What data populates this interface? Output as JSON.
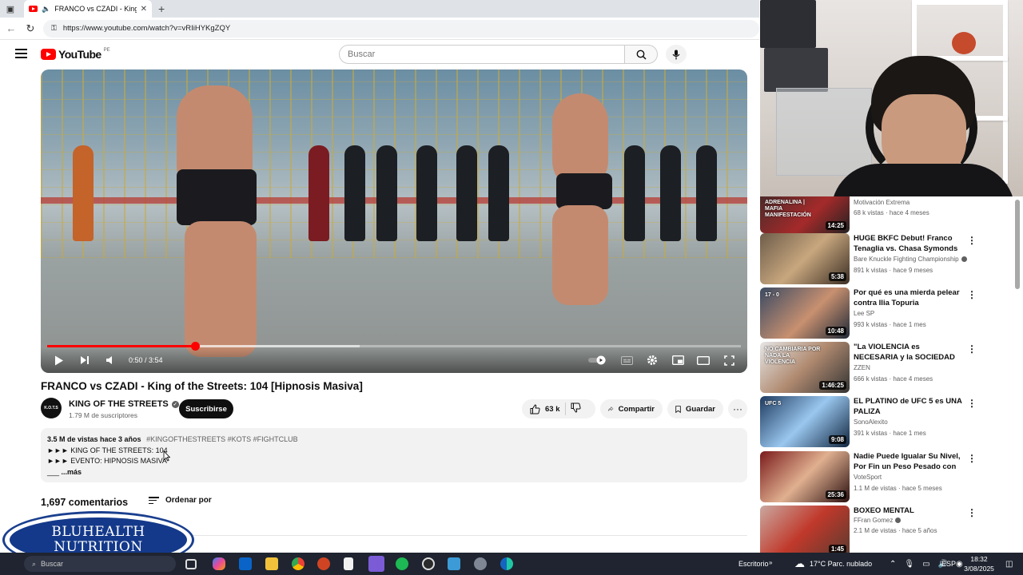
{
  "browser": {
    "tab_title": "FRANCO vs CZADI - King of",
    "url": "https://www.youtube.com/watch?v=vRIiHYKgZQY"
  },
  "youtube": {
    "logo_text": "YouTube",
    "country_code": "PE",
    "search_placeholder": "Buscar"
  },
  "player": {
    "time_label": "0:50 / 3:54",
    "progress": 0.2137,
    "buffered": 0.45
  },
  "video": {
    "title": "FRANCO vs CZADI - King of the Streets: 104 [Hipnosis Masiva]",
    "channel_name": "KING OF THE STREETS",
    "channel_avatar_text": "K.O.T.S",
    "subscribers": "1.79 M de suscriptores",
    "subscribe_label": "Suscribirse",
    "likes": "63 k",
    "share_label": "Compartir",
    "save_label": "Guardar",
    "more_glyph": "···"
  },
  "description": {
    "views_date": "3.5 M de vistas  hace 3 años",
    "hashtags": "#KINGOFTHESTREETS #KOTS #FIGHTCLUB",
    "line1": "►►► KING OF THE STREETS: 104",
    "line2": "►►► EVENTO: HIPNOSIS MASIVA",
    "line3_prefix": "___",
    "more_label": "...más"
  },
  "comments": {
    "count_label": "1,697 comentarios",
    "sort_label": "Ordenar por"
  },
  "overlay_logo": {
    "line1": "BLUHEALTH",
    "line2": "NUTRITION"
  },
  "recommendations": [
    {
      "title": "",
      "channel": "Motivación Extrema",
      "verified": false,
      "meta": "68 k vistas · hace 4 meses",
      "duration": "14:25",
      "thumb_text": "ADRENALINA | MAFIA MANIFESTACIÓN"
    },
    {
      "title": "HUGE BKFC Debut! Franco Tenaglia vs. Chasa Symonds",
      "channel": "Bare Knuckle Fighting Championship",
      "verified": true,
      "meta": "891 k vistas · hace 9 meses",
      "duration": "5:38",
      "thumb_text": ""
    },
    {
      "title": "Por qué es una mierda pelear contra Ilia Topuria",
      "channel": "Lee SP",
      "verified": false,
      "meta": "993 k vistas · hace 1 mes",
      "duration": "10:48",
      "thumb_text": "17 - 0"
    },
    {
      "title": "\"La VIOLENCIA es NECESARIA y la SOCIEDAD es DÉBIL\" | Franc...",
      "channel": "ZZEN",
      "verified": false,
      "meta": "666 k vistas · hace 4 meses",
      "duration": "1:46:25",
      "thumb_text": "NO CAMBIARIA POR NADA LA VIOLENCIA"
    },
    {
      "title": "EL PLATINO de UFC 5 es UNA PALIZA",
      "channel": "SonoAlexito",
      "verified": false,
      "meta": "391 k vistas · hace 1 mes",
      "duration": "9:08",
      "thumb_text": "UFC 5"
    },
    {
      "title": "Nadie Puede Igualar Su Nivel, Por Fin un Peso Pesado con ...",
      "channel": "VoteSport",
      "verified": false,
      "meta": "1.1 M de vistas · hace 5 meses",
      "duration": "25:36",
      "thumb_text": ""
    },
    {
      "title": "BOXEO MENTAL",
      "channel": "FFran Gomez",
      "verified": true,
      "meta": "2.1 M de vistas · hace 5 años",
      "duration": "1:45",
      "thumb_text": ""
    }
  ],
  "taskbar": {
    "search_label": "Buscar",
    "desktop_label": "Escritorio",
    "weather": "17°C  Parc. nublado",
    "language": "ESP",
    "time": "18:32",
    "date": "3/08/2025"
  },
  "colors": {
    "youtube_red": "#ff0000",
    "brand_blue": "#14398a",
    "taskbar": "#1f2430"
  }
}
